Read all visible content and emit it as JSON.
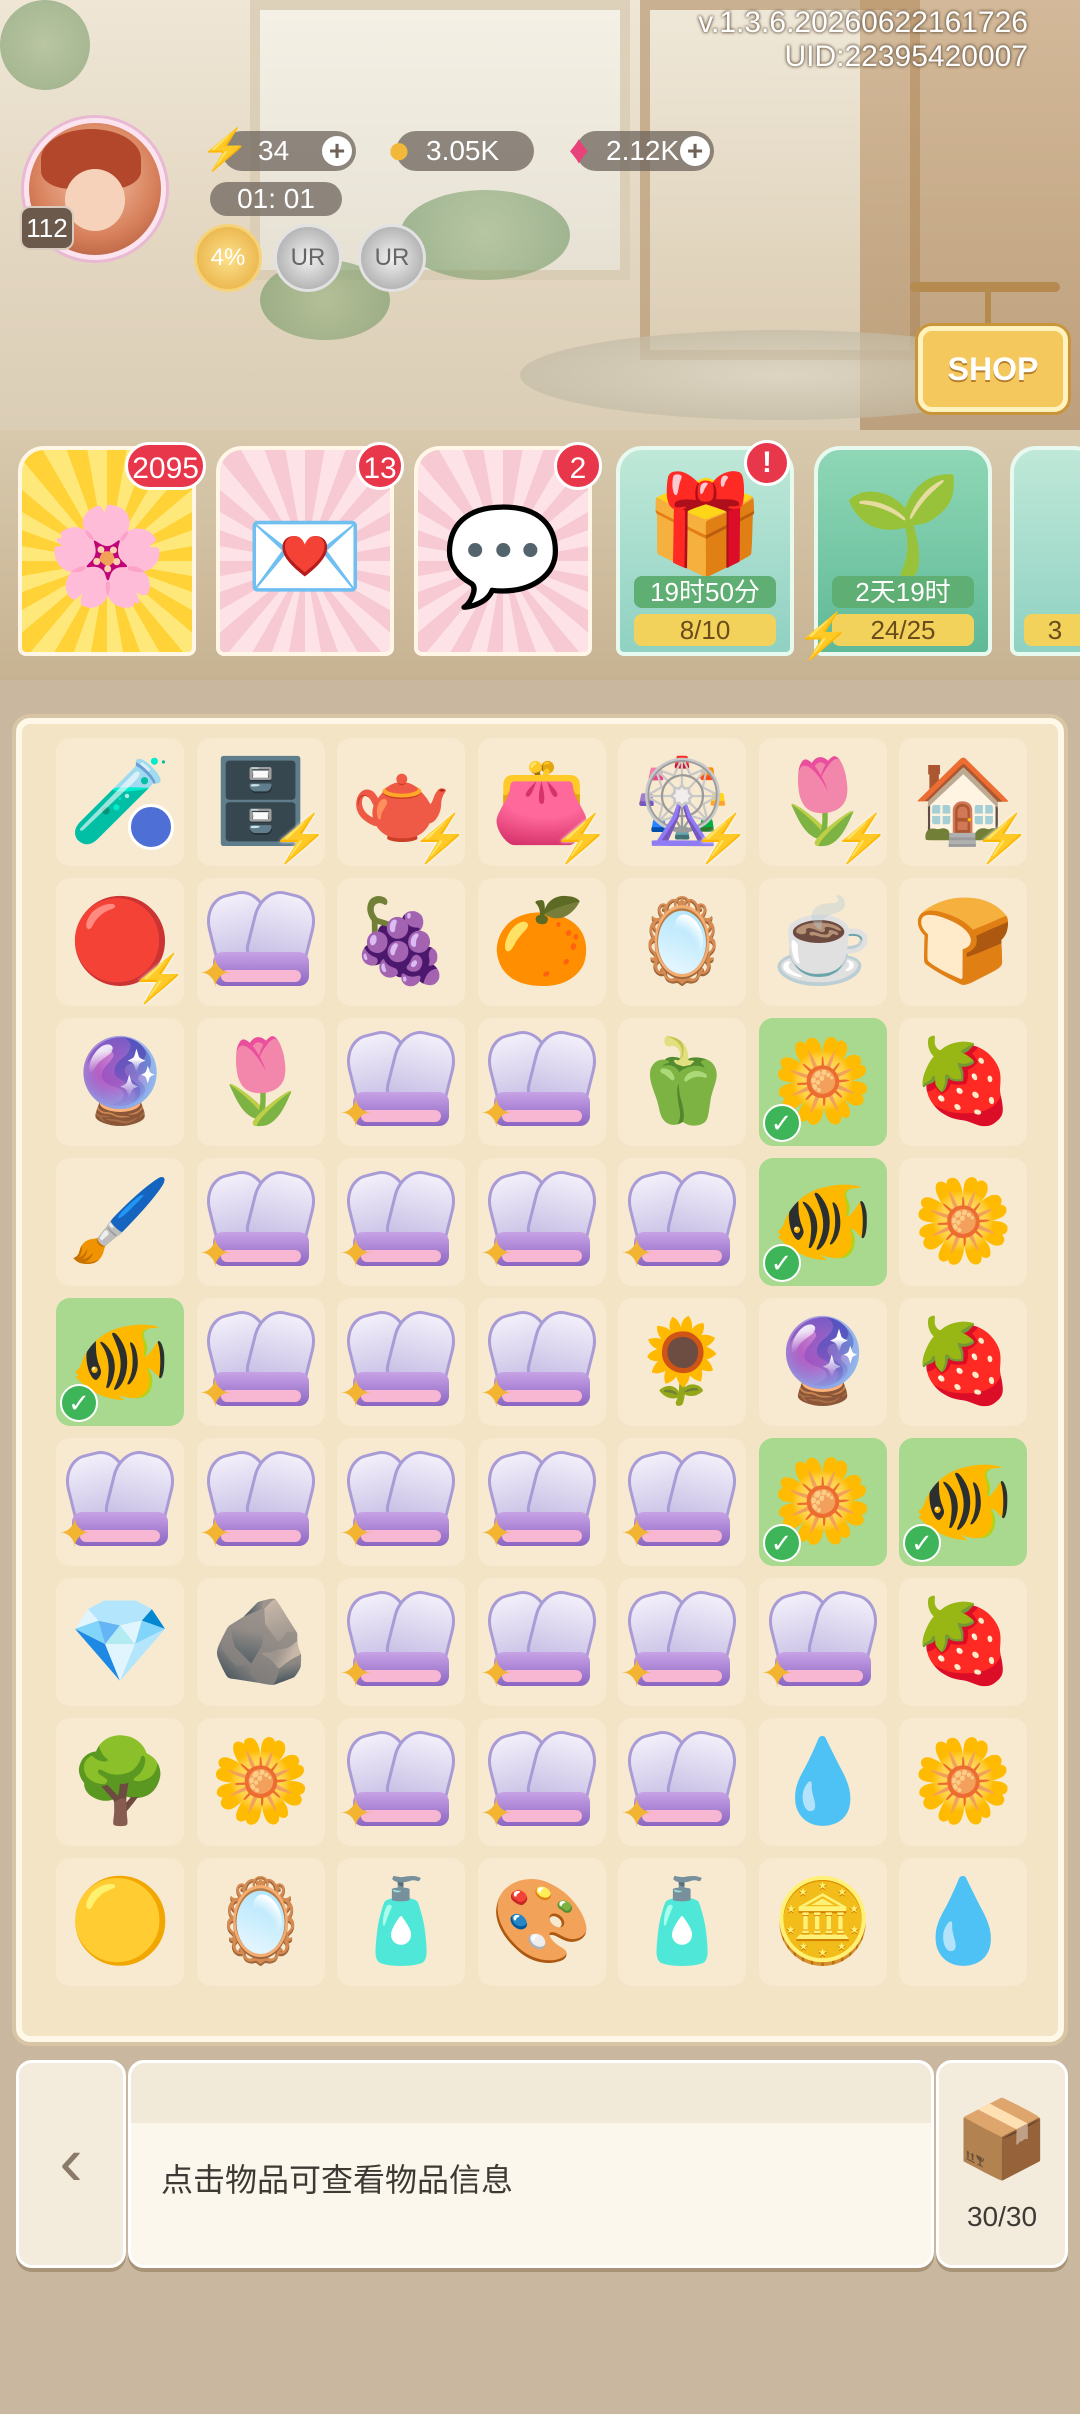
{
  "hud": {
    "version": "v.1.3.6.20260622161726",
    "uid": "UID:22395420007",
    "level": "112",
    "energy": "34",
    "coins": "3.05K",
    "gems": "2.12K",
    "timer": "01: 01",
    "boost_label": "4%",
    "shop_label": "SHOP"
  },
  "cards": [
    {
      "badge": "2095",
      "icon": "flower-dome"
    },
    {
      "badge": "13",
      "icon": "letter"
    },
    {
      "badge": "2",
      "icon": "chat-bubble"
    },
    {
      "time": "19时50分",
      "progress": "8/10",
      "alert": "!",
      "icon": "gift-box"
    },
    {
      "time": "2天19时",
      "progress": "24/25",
      "icon": "garden-shovel"
    },
    {
      "progress": "3",
      "icon": "partial-card"
    }
  ],
  "board": {
    "rows": [
      [
        "potion",
        "cabinet",
        "teapot",
        "cosmetic-bag",
        "garden-wheel",
        "flower-bed",
        "play-house"
      ],
      [
        "red-orb",
        "shell-pack",
        "green-grapes",
        "mandarins",
        "compact",
        "cat-teacup",
        "bread"
      ],
      [
        "glass-dome-blue",
        "calla-lily",
        "shell-pack",
        "shell-pack",
        "green-sprite",
        "yellow-flowers",
        "red-crystal"
      ],
      [
        "brushes",
        "shell-pack",
        "shell-pack",
        "shell-pack",
        "shell-pack",
        "clownfish",
        "osmanthus"
      ],
      [
        "clownfish",
        "shell-pack",
        "shell-pack",
        "shell-pack",
        "yellow-lily",
        "glass-dome-purple",
        "raspberries"
      ],
      [
        "shell-pack",
        "shell-pack",
        "shell-pack",
        "shell-pack",
        "shell-pack",
        "yellow-flowers",
        "clownfish"
      ],
      [
        "purple-crystal",
        "stone-emblem",
        "shell-pack",
        "shell-pack",
        "shell-pack",
        "shell-pack",
        "raspberries"
      ],
      [
        "glass-dome-tree",
        "osmanthus",
        "shell-pack",
        "shell-pack",
        "shell-pack",
        "amber-drop",
        "osmanthus"
      ],
      [
        "gold-nugget",
        "powder-compact",
        "blush-compact",
        "eyeshadow",
        "foundation",
        "gold-coin",
        "water-drop"
      ]
    ]
  },
  "bottom": {
    "hint": "点击物品可查看物品信息",
    "storage": "30/30"
  }
}
